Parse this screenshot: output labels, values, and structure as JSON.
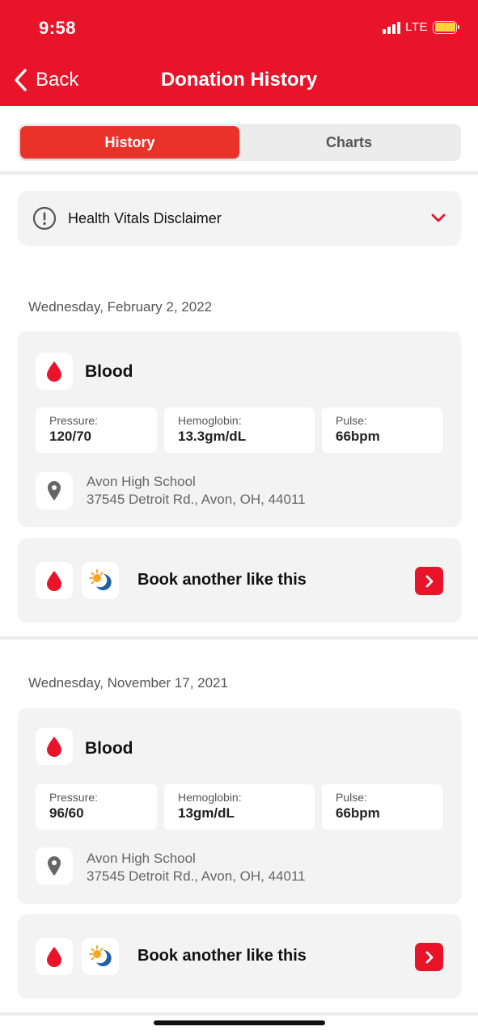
{
  "status_bar": {
    "time": "9:58",
    "network": "LTE"
  },
  "nav": {
    "back_label": "Back",
    "title": "Donation History"
  },
  "tabs": [
    {
      "label": "History",
      "active": true
    },
    {
      "label": "Charts",
      "active": false
    }
  ],
  "disclaimer": {
    "label": "Health Vitals Disclaimer",
    "icon": "exclamation-circle-icon",
    "expand_icon": "chevron-down-icon"
  },
  "donations": [
    {
      "date": "Wednesday, February 2, 2022",
      "type": "Blood",
      "stats": [
        {
          "label": "Pressure:",
          "value": "120/70"
        },
        {
          "label": "Hemoglobin:",
          "value": "13.3gm/dL"
        },
        {
          "label": "Pulse:",
          "value": "66bpm"
        }
      ],
      "location_name": "Avon High School",
      "location_address": "37545 Detroit Rd., Avon, OH, 44011",
      "book_label": "Book another like this"
    },
    {
      "date": "Wednesday, November 17, 2021",
      "type": "Blood",
      "stats": [
        {
          "label": "Pressure:",
          "value": "96/60"
        },
        {
          "label": "Hemoglobin:",
          "value": "13gm/dL"
        },
        {
          "label": "Pulse:",
          "value": "66bpm"
        }
      ],
      "location_name": "Avon High School",
      "location_address": "37545 Detroit Rd., Avon, OH, 44011",
      "book_label": "Book another like this"
    }
  ],
  "colors": {
    "brand_red": "#e9132a",
    "active_tab": "#e9322a",
    "card_bg": "#f3f3f3",
    "battery": "#ffd43b",
    "sun": "#f5a623",
    "moon": "#1f5fa8"
  }
}
